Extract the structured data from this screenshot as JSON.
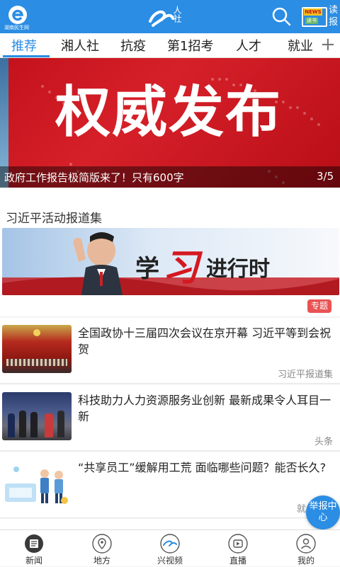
{
  "header": {
    "logo_text": "湖南民生网",
    "brand_text": "人社",
    "news_badge": "NEWS",
    "news_label_top": "读",
    "news_label_bottom": "报",
    "news_sub": "读书"
  },
  "tabs": [
    {
      "label": "推荐",
      "active": true
    },
    {
      "label": "湘人社"
    },
    {
      "label": "抗疫"
    },
    {
      "label": "第1招考"
    },
    {
      "label": "人才"
    },
    {
      "label": "就业"
    }
  ],
  "tab_add_symbol": "+",
  "banner": {
    "headline": "权威发布",
    "caption": "政府工作报告极简版来了！只有600字",
    "counter": "3/5"
  },
  "section": {
    "title": "习近平活动报道集",
    "banner_text_1": "学",
    "banner_text_2": "习",
    "banner_text_3": "进行时",
    "tag": "专题"
  },
  "news": [
    {
      "title": "全国政协十三届四次会议在京开幕 习近平等到会祝贺",
      "source": "习近平报道集"
    },
    {
      "title": "科技助力人力资源服务业创新 最新成果令人耳目一新",
      "source": "头条"
    },
    {
      "title": "“共享员工”缓解用工荒 面临哪些问题？能否长久?",
      "source": "就"
    }
  ],
  "report_button": {
    "line1": "举报中",
    "line2": "心"
  },
  "bottom_nav": [
    {
      "label": "新闻",
      "icon": "news-icon",
      "active": true
    },
    {
      "label": "地方",
      "icon": "location-icon"
    },
    {
      "label": "兴视频",
      "icon": "video-icon"
    },
    {
      "label": "直播",
      "icon": "live-icon"
    },
    {
      "label": "我的",
      "icon": "profile-icon"
    }
  ],
  "colors": {
    "accent": "#2b8de3",
    "banner_red": "#c3111b",
    "tag_red": "#e95353"
  }
}
